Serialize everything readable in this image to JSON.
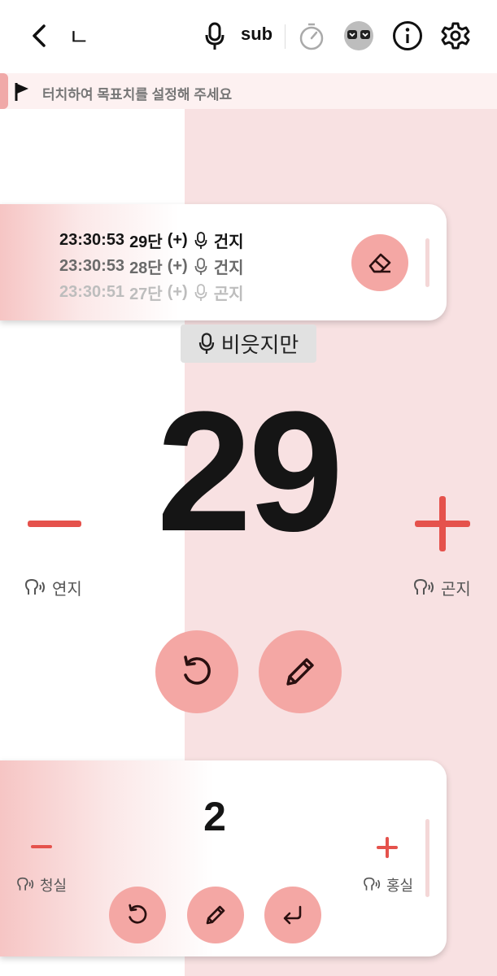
{
  "colors": {
    "accent": "#e5524c",
    "pink_bg": "#f8e1e2",
    "button": "#f4a7a4"
  },
  "topbar": {
    "icons": [
      "back-arrow-icon",
      "korean-letter-icon",
      "microphone-icon",
      "stopwatch-icon",
      "eyes-icon",
      "info-icon",
      "gear-icon"
    ],
    "letter": "ㄴ",
    "sub_label": "sub"
  },
  "goal": {
    "text": "터치하여 목표치를 설정해 주세요"
  },
  "history": [
    {
      "time": "23:30:53",
      "step": "29단",
      "sign": "(+)",
      "label": "건지"
    },
    {
      "time": "23:30:53",
      "step": "28단",
      "sign": "(+)",
      "label": "건지"
    },
    {
      "time": "23:30:51",
      "step": "27단",
      "sign": "(+)",
      "label": "곤지"
    }
  ],
  "voice": {
    "recognized": "비읏지만"
  },
  "counter": {
    "value": "29",
    "minus_label": "연지",
    "plus_label": "곤지"
  },
  "sub_counter": {
    "value": "2",
    "minus_label": "청실",
    "plus_label": "홍실"
  }
}
